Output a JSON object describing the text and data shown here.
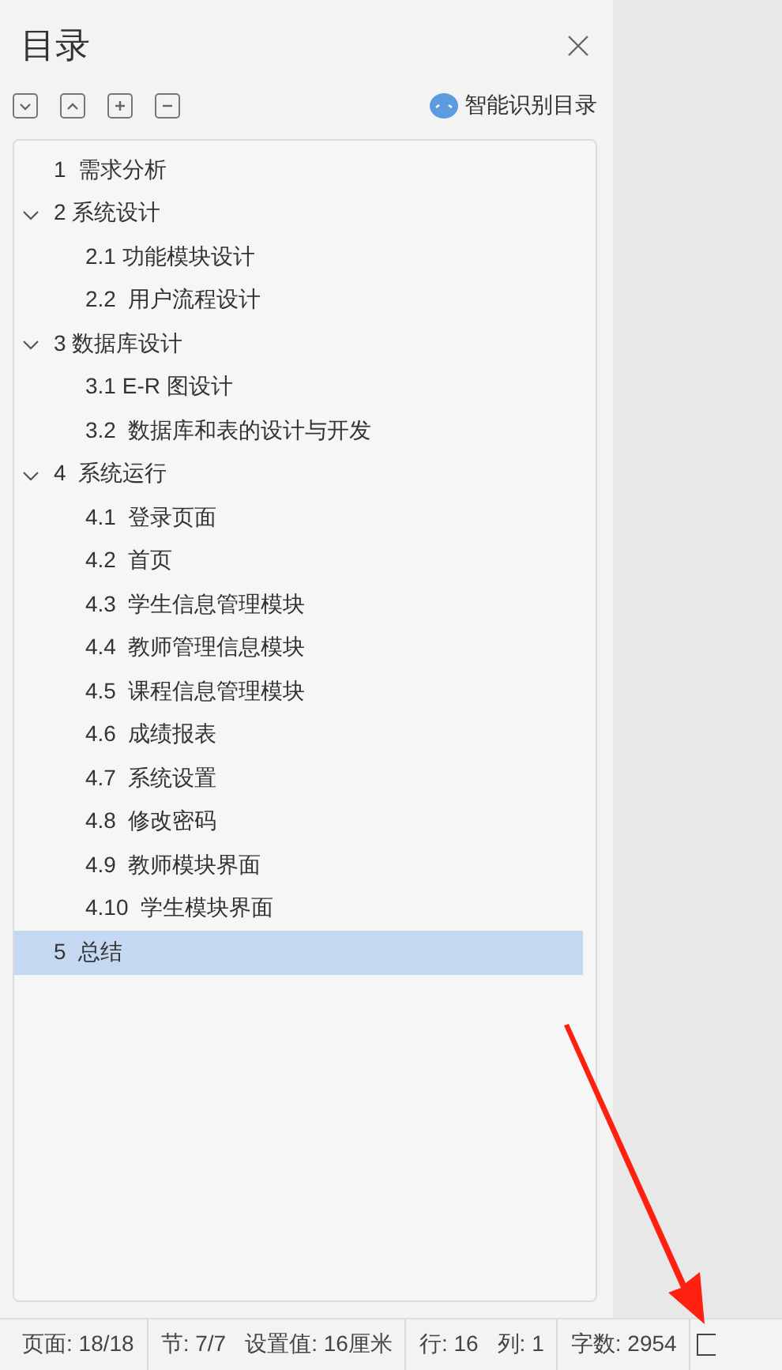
{
  "panel": {
    "title": "目录",
    "smart_button": "智能识别目录"
  },
  "tree": [
    {
      "label": "1  需求分析",
      "selected": false
    },
    {
      "label": "2 系统设计",
      "selected": false,
      "expanded": true,
      "children": [
        {
          "label": "2.1 功能模块设计",
          "selected": false
        },
        {
          "label": "2.2  用户流程设计",
          "selected": false
        }
      ]
    },
    {
      "label": "3 数据库设计",
      "selected": false,
      "expanded": true,
      "children": [
        {
          "label": "3.1 E-R 图设计",
          "selected": false
        },
        {
          "label": "3.2  数据库和表的设计与开发",
          "selected": false
        }
      ]
    },
    {
      "label": "4  系统运行",
      "selected": false,
      "expanded": true,
      "children": [
        {
          "label": "4.1  登录页面",
          "selected": false
        },
        {
          "label": "4.2  首页",
          "selected": false
        },
        {
          "label": "4.3  学生信息管理模块",
          "selected": false
        },
        {
          "label": "4.4  教师管理信息模块",
          "selected": false
        },
        {
          "label": "4.5  课程信息管理模块",
          "selected": false
        },
        {
          "label": "4.6  成绩报表",
          "selected": false
        },
        {
          "label": "4.7  系统设置",
          "selected": false
        },
        {
          "label": "4.8  修改密码",
          "selected": false
        },
        {
          "label": "4.9  教师模块界面",
          "selected": false
        },
        {
          "label": "4.10  学生模块界面",
          "selected": false
        }
      ]
    },
    {
      "label": "5  总结",
      "selected": true
    }
  ],
  "status_bar": [
    [
      "页面: 18/18"
    ],
    [
      "节: 7/7",
      "设置值: 16厘米"
    ],
    [
      "行: 16",
      "列: 1"
    ],
    [
      "字数: 2954"
    ]
  ]
}
